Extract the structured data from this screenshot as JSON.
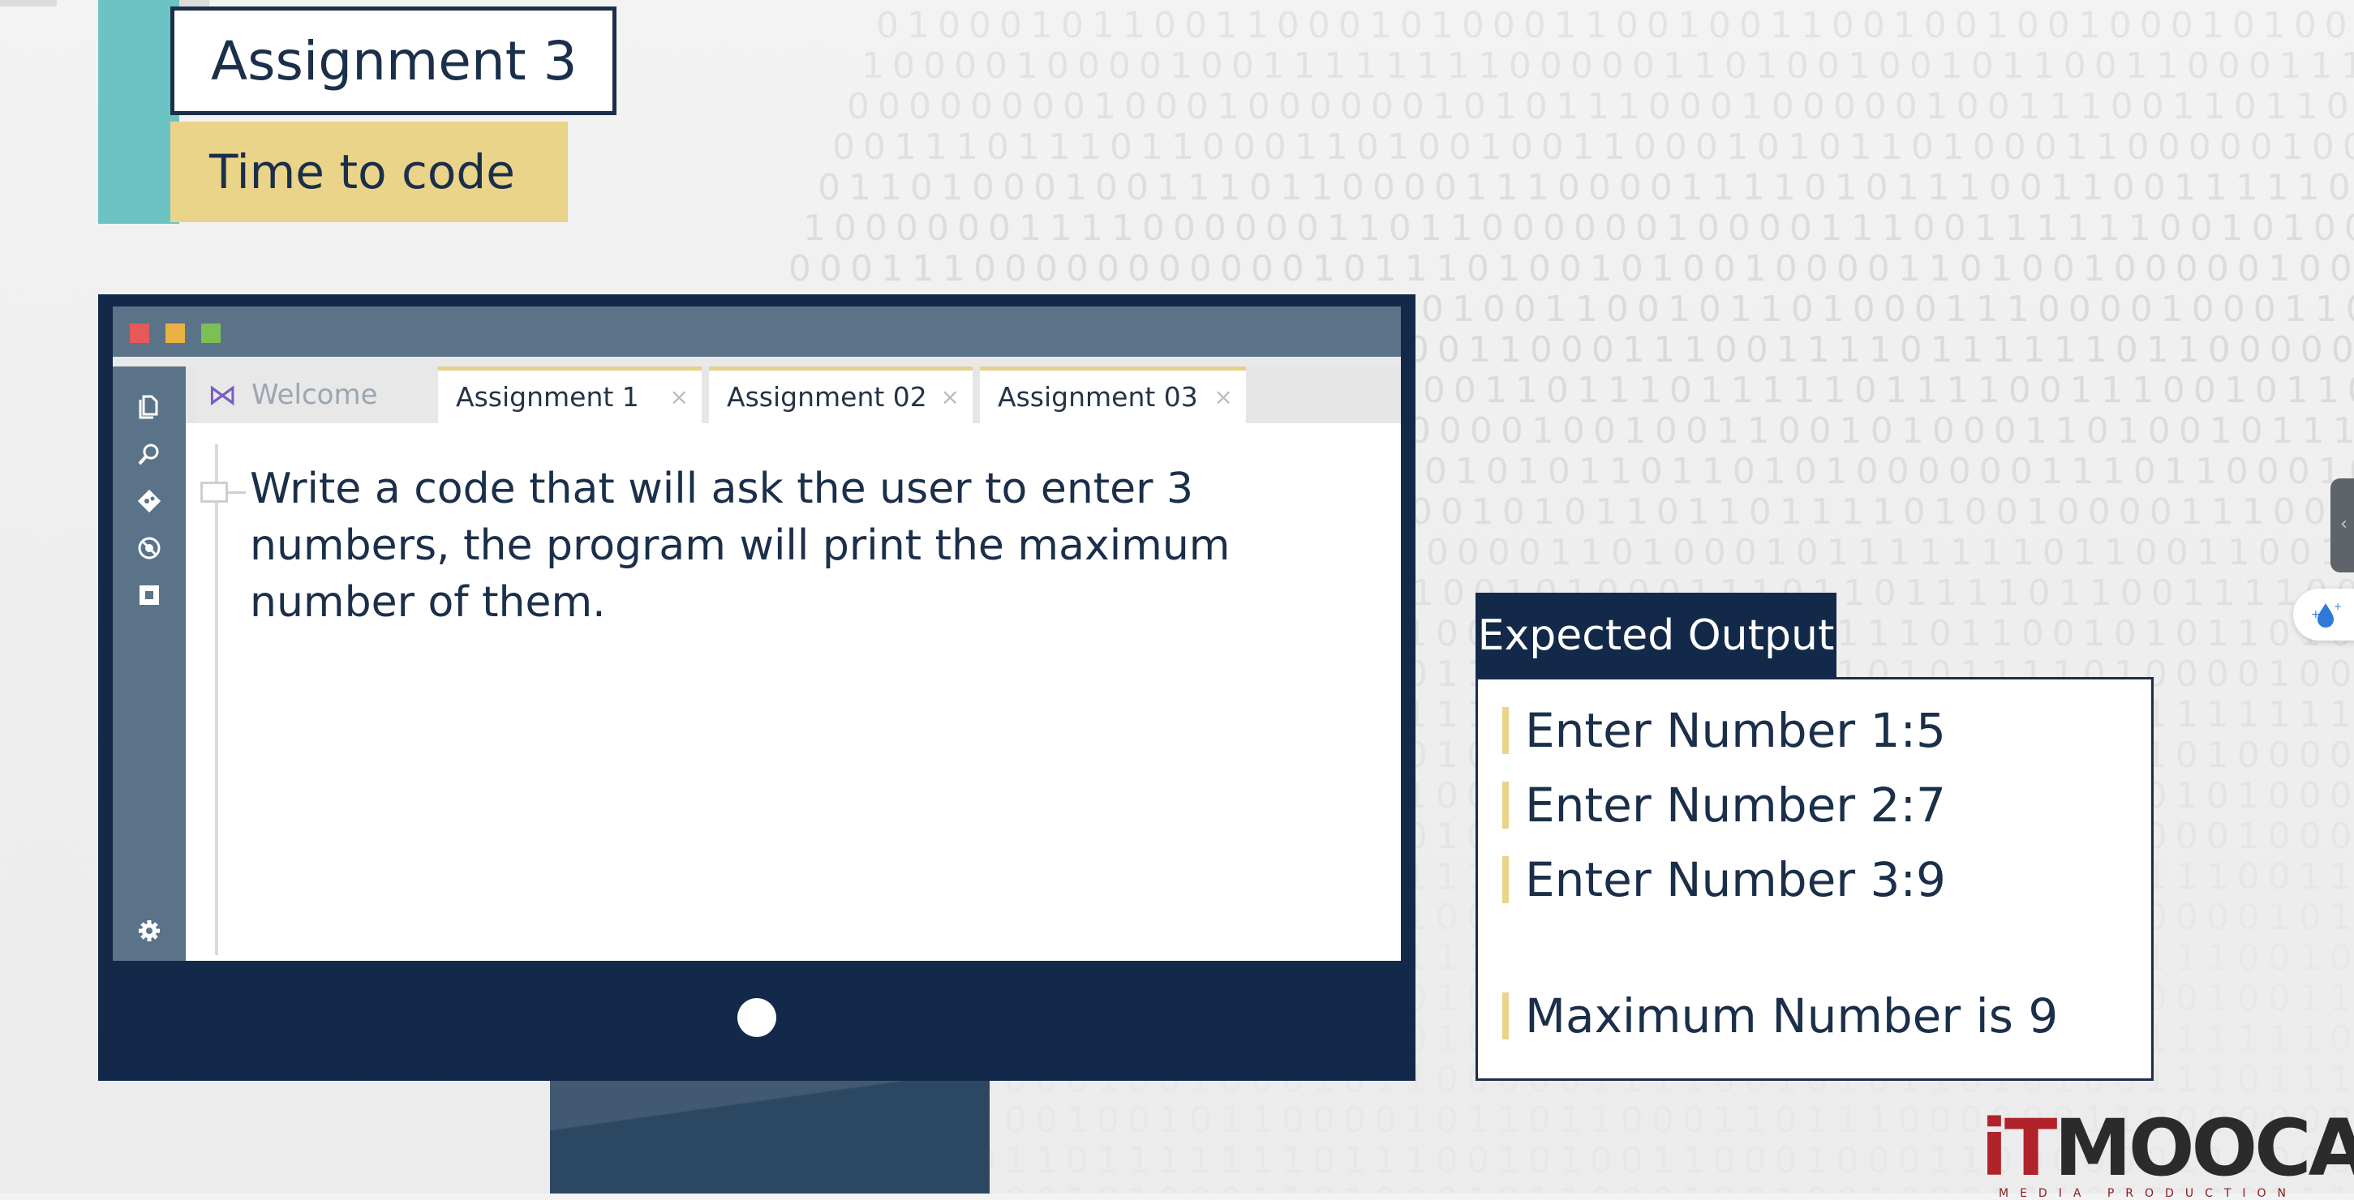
{
  "slide": {
    "title": "Assignment 3",
    "subtitle": "Time to code"
  },
  "editor": {
    "window_buttons": [
      {
        "name": "close-window-button",
        "color": "#e5595a"
      },
      {
        "name": "minimize-window-button",
        "color": "#eab243"
      },
      {
        "name": "maximize-window-button",
        "color": "#7cbf55"
      }
    ],
    "activity_icons": [
      "explorer-icon",
      "search-icon",
      "source-control-icon",
      "debug-icon",
      "extensions-icon"
    ],
    "settings_icon": "gear-icon",
    "tabs": [
      {
        "label": "Welcome",
        "icon": "visual-studio-icon",
        "active": false
      },
      {
        "label": "Assignment 1",
        "close": "×",
        "active": true
      },
      {
        "label": "Assignment 02",
        "close": "×",
        "active": true
      },
      {
        "label": "Assignment 03",
        "close": "×",
        "active": true
      }
    ],
    "content_lines": [
      "Write a code that will ask the user to enter 3",
      "numbers, the program will print the maximum",
      "number of them."
    ]
  },
  "expected_output": {
    "header": "Expected Output",
    "lines": [
      "Enter Number 1:5",
      "Enter Number 2:7",
      "Enter Number 3:9",
      "Maximum Number is 9"
    ]
  },
  "logo": {
    "it": "iT",
    "name": "MOOCA",
    "tagline": "MEDIA PRODUCTION"
  },
  "colors": {
    "navy": "#13294a",
    "teal": "#6cc3c4",
    "gold": "#ead489",
    "slate": "#5b7388"
  }
}
